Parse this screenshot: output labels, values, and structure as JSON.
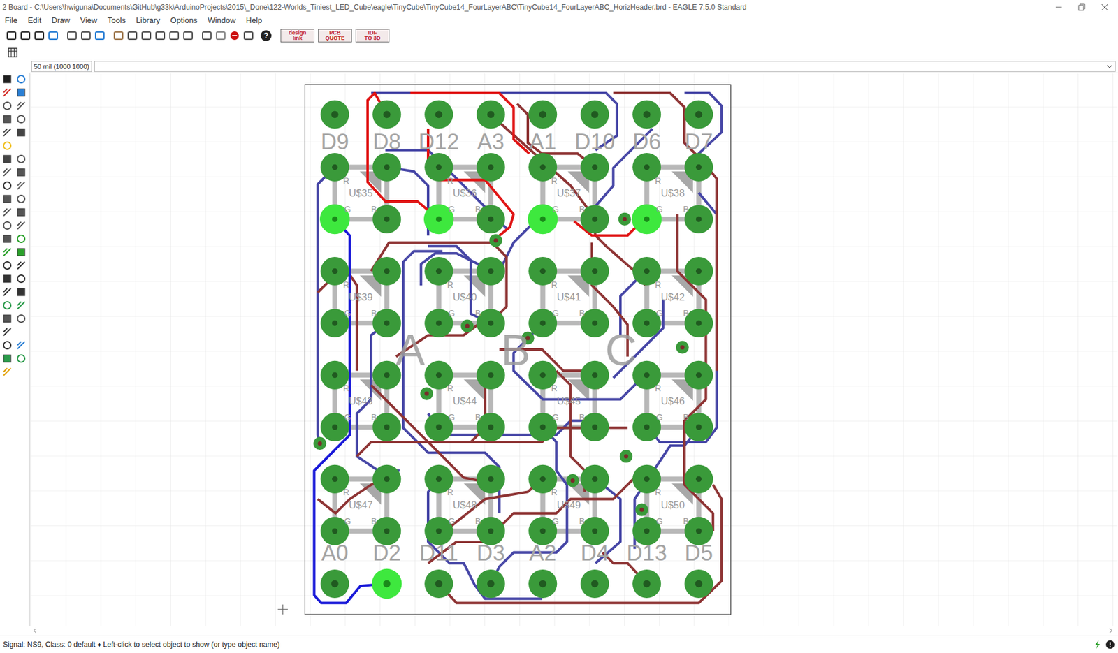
{
  "window": {
    "title": "2 Board - C:\\Users\\hwiguna\\Documents\\GitHub\\g33k\\ArduinoProjects\\2015\\_Done\\122-Worlds_Tiniest_LED_Cube\\eagle\\TinyCube\\TinyCube14_FourLayerABC\\TinyCube14_FourLayerABC_HorizHeader.brd - EAGLE 7.5.0 Standard"
  },
  "menu": [
    "File",
    "Edit",
    "Draw",
    "View",
    "Tools",
    "Library",
    "Options",
    "Window",
    "Help"
  ],
  "toolbar": {
    "help": "?",
    "buttons": [
      {
        "line1": "design",
        "line2": "link"
      },
      {
        "line1": "PCB",
        "line2": "QUOTE"
      },
      {
        "line1": "IDF",
        "line2": "TO 3D"
      }
    ]
  },
  "command_bar": {
    "grid": "50 mil (1000 1000)",
    "command": ""
  },
  "board": {
    "headers_top": [
      {
        "label": "D9",
        "highlighted": false
      },
      {
        "label": "D8",
        "highlighted": false
      },
      {
        "label": "D12",
        "highlighted": false
      },
      {
        "label": "A3",
        "highlighted": false
      },
      {
        "label": "A1",
        "highlighted": false
      },
      {
        "label": "D10",
        "highlighted": false
      },
      {
        "label": "D6",
        "highlighted": false
      },
      {
        "label": "D7",
        "highlighted": false
      }
    ],
    "headers_bottom": [
      {
        "label": "A0",
        "highlighted": false
      },
      {
        "label": "D2",
        "highlighted": true
      },
      {
        "label": "D11",
        "highlighted": false
      },
      {
        "label": "D3",
        "highlighted": false
      },
      {
        "label": "A2",
        "highlighted": false
      },
      {
        "label": "D4",
        "highlighted": false
      },
      {
        "label": "D13",
        "highlighted": false
      },
      {
        "label": "D5",
        "highlighted": false
      }
    ],
    "parts": [
      {
        "name": "U$35",
        "pins": [
          "R",
          "G",
          "B"
        ],
        "highlighted": [
          false,
          false,
          true,
          false
        ]
      },
      {
        "name": "U$36",
        "pins": [
          "R",
          "G",
          "B"
        ],
        "highlighted": [
          false,
          false,
          true,
          false
        ]
      },
      {
        "name": "U$37",
        "pins": [
          "R",
          "G",
          "B"
        ],
        "highlighted": [
          false,
          false,
          true,
          false
        ]
      },
      {
        "name": "U$38",
        "pins": [
          "R",
          "G",
          "B"
        ],
        "highlighted": [
          false,
          false,
          true,
          false
        ]
      },
      {
        "name": "U$39",
        "pins": [
          "R",
          "G",
          "B"
        ],
        "highlighted": [
          false,
          false,
          false,
          false
        ]
      },
      {
        "name": "U$40",
        "pins": [
          "R",
          "G",
          "B"
        ],
        "highlighted": [
          false,
          false,
          false,
          false
        ]
      },
      {
        "name": "U$41",
        "pins": [
          "R",
          "G",
          "B"
        ],
        "highlighted": [
          false,
          false,
          false,
          false
        ]
      },
      {
        "name": "U$42",
        "pins": [
          "R",
          "G",
          "B"
        ],
        "highlighted": [
          false,
          false,
          false,
          false
        ]
      },
      {
        "name": "U$43",
        "pins": [
          "R",
          "G",
          "B"
        ],
        "highlighted": [
          false,
          false,
          false,
          false
        ]
      },
      {
        "name": "U$44",
        "pins": [
          "R",
          "G",
          "B"
        ],
        "highlighted": [
          false,
          false,
          false,
          false
        ]
      },
      {
        "name": "U$45",
        "pins": [
          "R",
          "G",
          "B"
        ],
        "highlighted": [
          false,
          false,
          false,
          false
        ]
      },
      {
        "name": "U$46",
        "pins": [
          "R",
          "G",
          "B"
        ],
        "highlighted": [
          false,
          false,
          false,
          false
        ]
      },
      {
        "name": "U$47",
        "pins": [
          "R",
          "G",
          "B"
        ],
        "highlighted": [
          false,
          false,
          false,
          false
        ]
      },
      {
        "name": "U$48",
        "pins": [
          "R",
          "G",
          "B"
        ],
        "highlighted": [
          false,
          false,
          false,
          false
        ]
      },
      {
        "name": "U$49",
        "pins": [
          "R",
          "G",
          "B"
        ],
        "highlighted": [
          false,
          false,
          false,
          false
        ]
      },
      {
        "name": "U$50",
        "pins": [
          "R",
          "G",
          "B"
        ],
        "highlighted": [
          false,
          false,
          false,
          false
        ]
      }
    ],
    "group_labels": [
      "A",
      "B",
      "C"
    ]
  },
  "status_bar": "Signal: NS9, Class: 0 default ♦ Left-click to select object to show (or type object name)"
}
